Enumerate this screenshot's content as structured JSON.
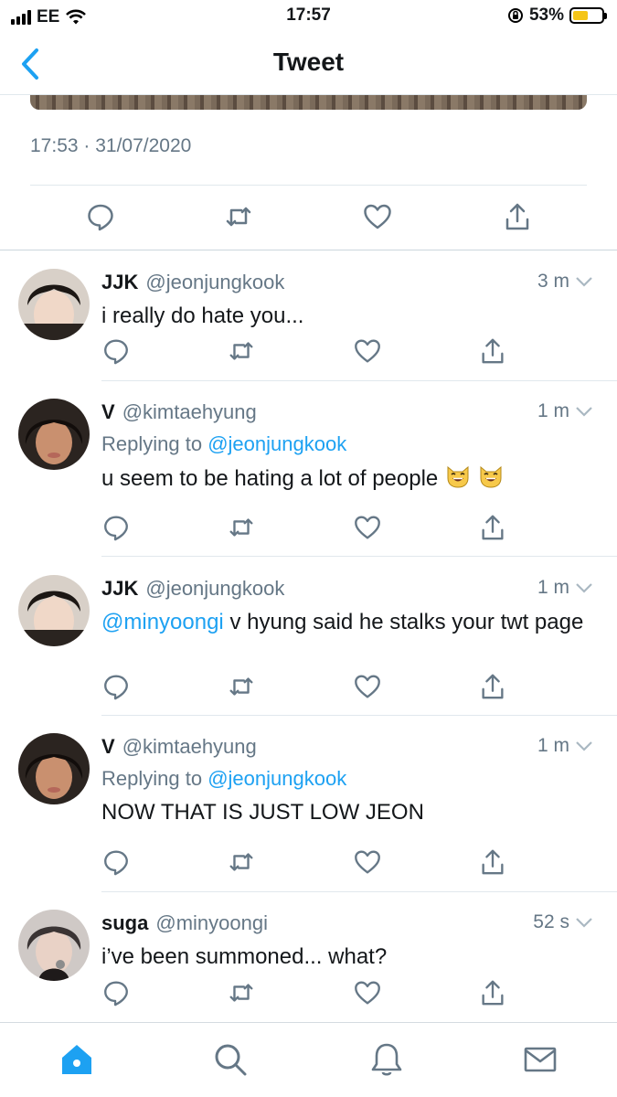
{
  "status_bar": {
    "carrier": "EE",
    "time": "17:57",
    "battery": "53%",
    "battery_level": 0.53
  },
  "nav": {
    "title": "Tweet",
    "back_icon": "chevron-left-icon"
  },
  "main_tweet": {
    "timestamp": "17:53 · 31/07/2020"
  },
  "replies": [
    {
      "name": "JJK",
      "handle": "@jeonjungkook",
      "time": "3 m",
      "replying_prefix": "",
      "replying_to": "",
      "mention": "",
      "text": "i really do hate you...",
      "emoji_count": 0
    },
    {
      "name": "V",
      "handle": "@kimtaehyung",
      "time": "1 m",
      "replying_prefix": "Replying to",
      "replying_to": "@jeonjungkook",
      "mention": "",
      "text": "u seem to be hating a lot of people",
      "emoji_count": 2
    },
    {
      "name": "JJK",
      "handle": "@jeonjungkook",
      "time": "1 m",
      "replying_prefix": "",
      "replying_to": "",
      "mention": "@minyoongi",
      "text": "v hyung said he stalks your twt page",
      "emoji_count": 0
    },
    {
      "name": "V",
      "handle": "@kimtaehyung",
      "time": "1 m",
      "replying_prefix": "Replying to",
      "replying_to": "@jeonjungkook",
      "mention": "",
      "text": "NOW THAT IS JUST LOW JEON",
      "emoji_count": 0
    },
    {
      "name": "suga",
      "handle": "@minyoongi",
      "time": "52 s",
      "replying_prefix": "",
      "replying_to": "",
      "mention": "",
      "text": "i’ve been summoned... what?",
      "emoji_count": 0
    }
  ],
  "tabs": [
    {
      "icon": "home-icon",
      "active": true
    },
    {
      "icon": "search-icon",
      "active": false
    },
    {
      "icon": "bell-icon",
      "active": false
    },
    {
      "icon": "mail-icon",
      "active": false
    }
  ],
  "colors": {
    "accent": "#1da1f2",
    "secondary_text": "#657786",
    "divider": "#e1e8ed"
  }
}
